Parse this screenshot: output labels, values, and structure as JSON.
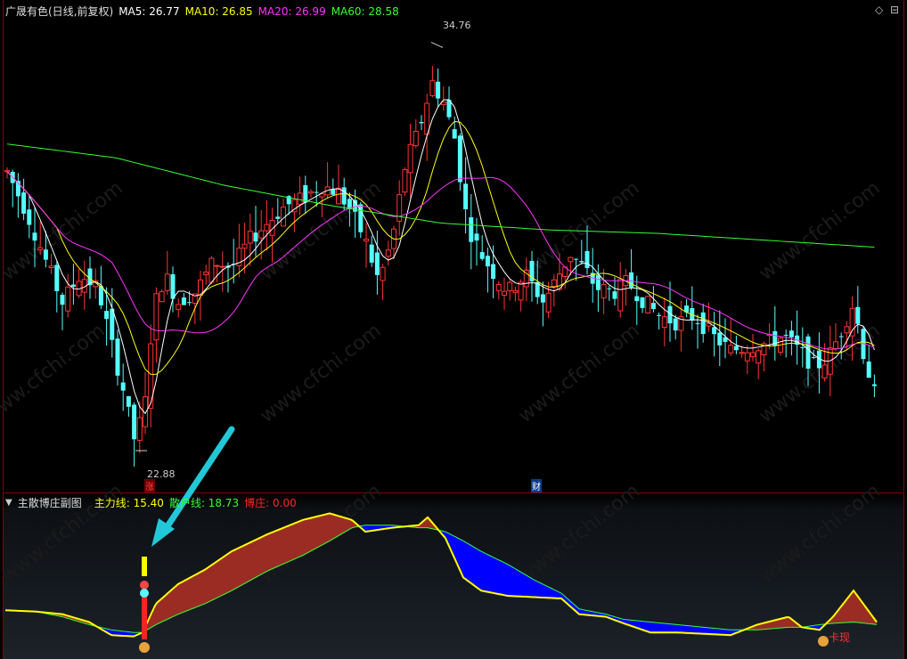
{
  "main_header": {
    "title": "广晟有色(日线,前复权)",
    "ma": [
      {
        "label": "MA5: 26.77",
        "color": "#ffffff"
      },
      {
        "label": "MA10: 26.85",
        "color": "#ffff00"
      },
      {
        "label": "MA20: 26.99",
        "color": "#ff33ff"
      },
      {
        "label": "MA60: 28.58",
        "color": "#33ff33"
      }
    ],
    "controls": [
      "◇",
      "⊟"
    ]
  },
  "annotations": {
    "high": "34.76",
    "low": "22.88",
    "zhang_badge": "涨",
    "cai_badge": "财"
  },
  "sub_header": {
    "title": "主散博庄副图",
    "zhuli": {
      "label": "主力线: 15.40",
      "color": "#ffff00"
    },
    "sanhu": {
      "label": "散户线: 18.73",
      "color": "#33ff33"
    },
    "bozhuang": {
      "label": "博庄: 0.00",
      "color": "#ff2222"
    }
  },
  "sub_badge": "卡现",
  "watermark": "www.cfchi.com",
  "colors": {
    "up": "#ff3333",
    "down": "#55ffff",
    "fill_up": "#9a2c24",
    "fill_down": "#0000ff",
    "frame": "#8b0000"
  },
  "chart_data": {
    "type": "candlestick",
    "title": "广晟有色(日线,前复权)",
    "ylim": [
      22.0,
      35.6
    ],
    "price_high": 34.76,
    "price_low": 22.88,
    "ma_latest": {
      "MA5": 26.77,
      "MA10": 26.85,
      "MA20": 26.99,
      "MA60": 28.58
    },
    "sub_indicator": {
      "name": "主散博庄副图",
      "主力线": 15.4,
      "散户线": 18.73,
      "博庄": 0.0
    }
  }
}
